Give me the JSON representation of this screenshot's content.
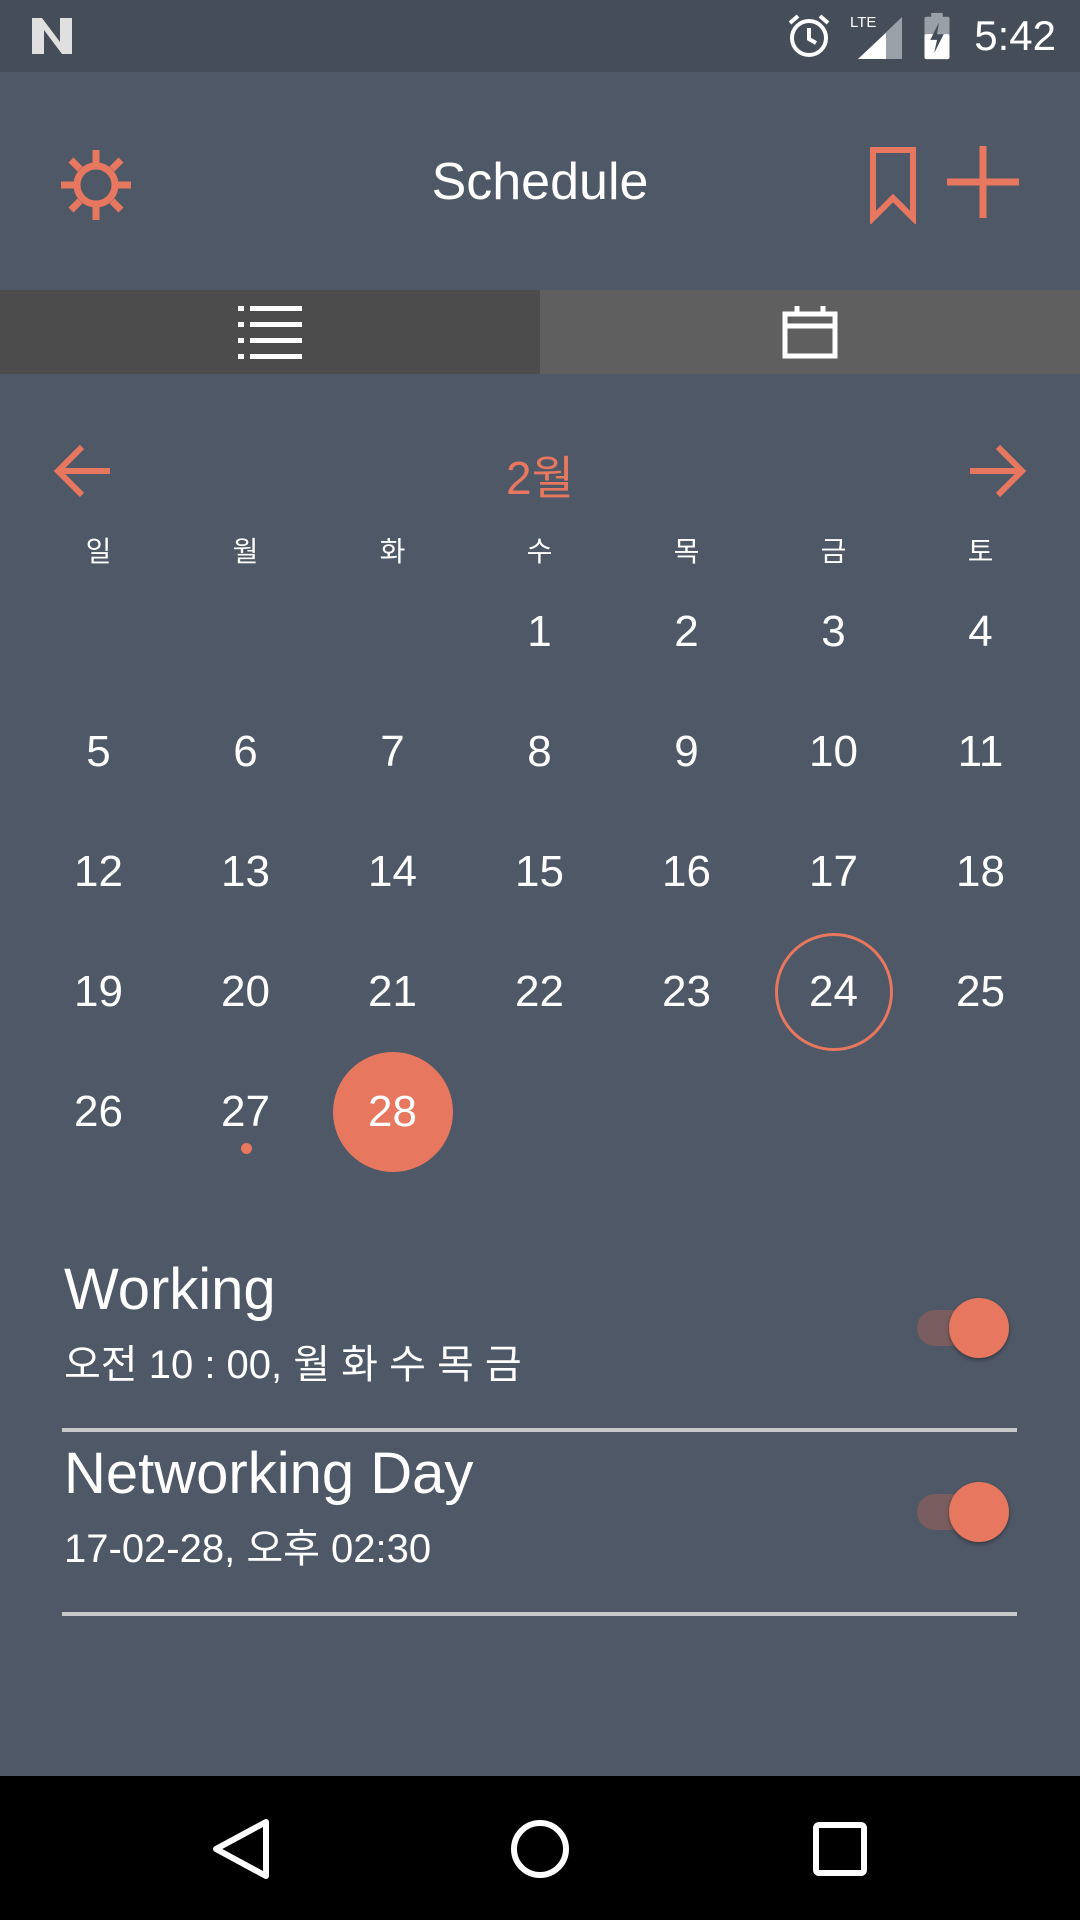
{
  "status_bar": {
    "time": "5:42",
    "network": "LTE"
  },
  "app_bar": {
    "title": "Schedule",
    "accent_color": "#e8775f",
    "icons": [
      "settings-gear-icon",
      "bookmark-icon",
      "plus-icon"
    ]
  },
  "tabs": [
    {
      "name": "list-view",
      "icon": "list-icon",
      "selected": false
    },
    {
      "name": "calendar-view",
      "icon": "calendar-icon",
      "selected": true
    }
  ],
  "calendar": {
    "month_label": "2월",
    "weekdays": [
      "일",
      "월",
      "화",
      "수",
      "목",
      "금",
      "토"
    ],
    "weeks": [
      [
        "",
        "",
        "",
        "1",
        "2",
        "3",
        "4"
      ],
      [
        "5",
        "6",
        "7",
        "8",
        "9",
        "10",
        "11"
      ],
      [
        "12",
        "13",
        "14",
        "15",
        "16",
        "17",
        "18"
      ],
      [
        "19",
        "20",
        "21",
        "22",
        "23",
        "24",
        "25"
      ],
      [
        "26",
        "27",
        "28",
        "",
        "",
        "",
        ""
      ]
    ],
    "today": "24",
    "selected": "28",
    "event_days": [
      "27"
    ]
  },
  "schedules": [
    {
      "title": "Working",
      "detail": "오전 10 : 00, 월 화 수 목 금",
      "enabled": true
    },
    {
      "title": "Networking Day",
      "detail": "17-02-28, 오후 02:30",
      "enabled": true
    }
  ],
  "nav_bar": {
    "buttons": [
      "back-icon",
      "home-icon",
      "recents-icon"
    ]
  }
}
